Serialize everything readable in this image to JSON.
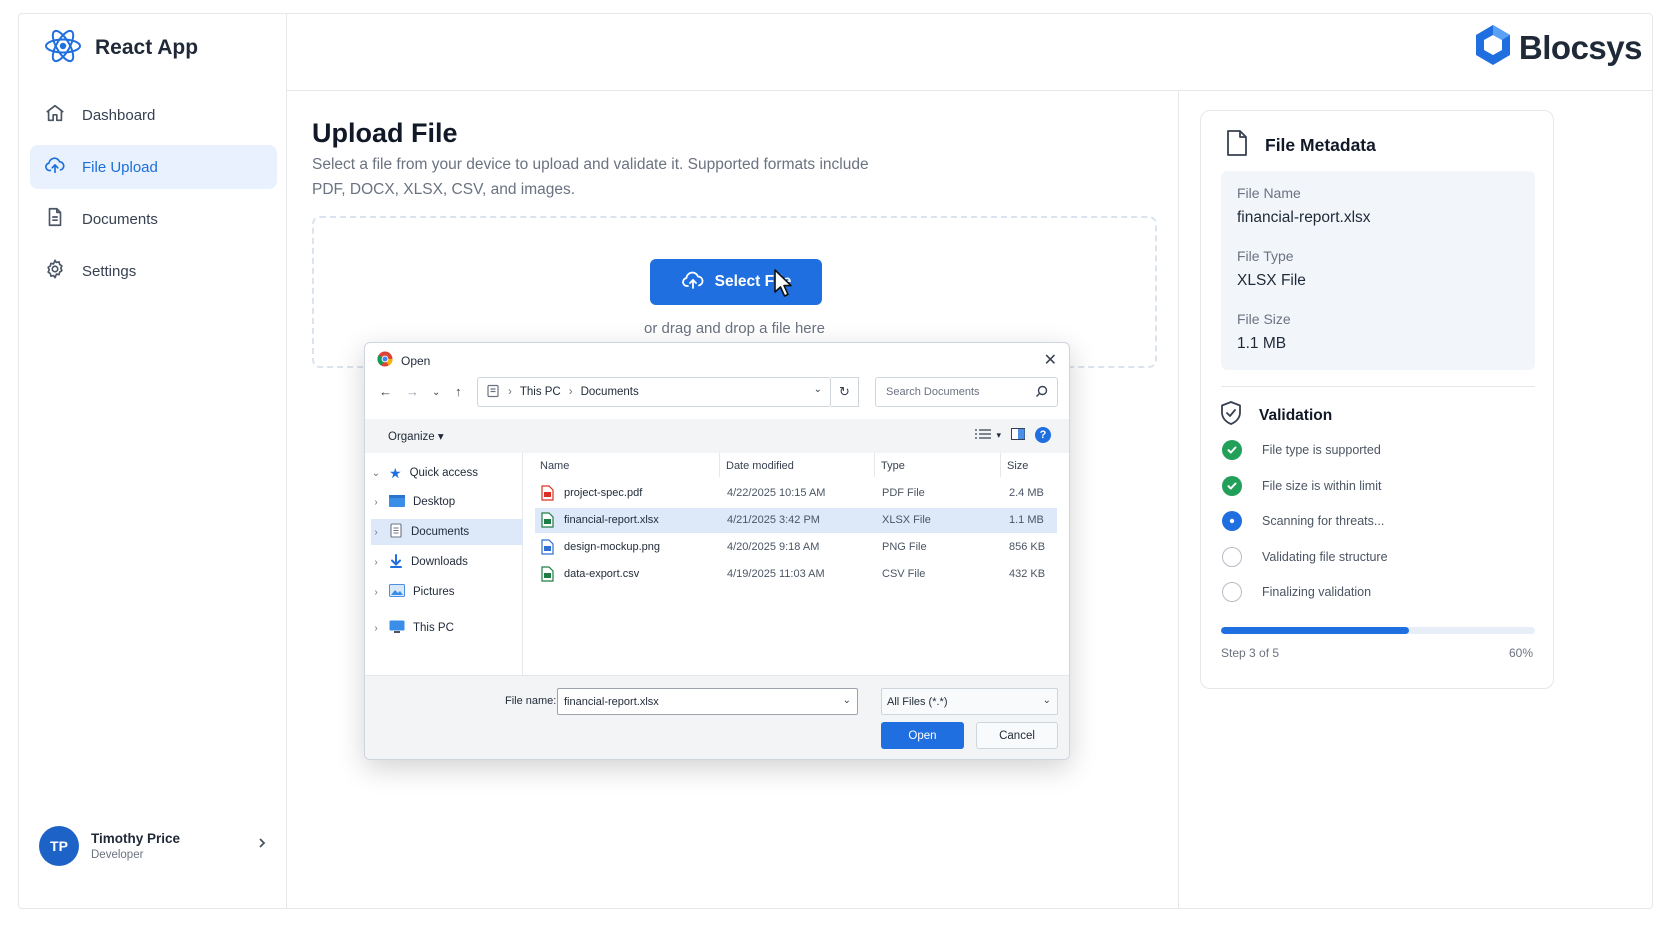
{
  "app": {
    "name": "React App"
  },
  "logo": {
    "text": "Blocsys"
  },
  "sidebar": {
    "items": [
      {
        "label": "Dashboard",
        "icon": "home-icon"
      },
      {
        "label": "File Upload",
        "icon": "cloud-upload-icon",
        "active": true
      },
      {
        "label": "Documents",
        "icon": "document-icon"
      },
      {
        "label": "Settings",
        "icon": "gear-icon"
      }
    ],
    "user": {
      "initials": "TP",
      "name": "Timothy Price",
      "role": "Developer"
    }
  },
  "main": {
    "title": "Upload File",
    "description": "Select a file from your device to upload and validate it. Supported formats include PDF, DOCX, XLSX, CSV, and images.",
    "select_button": "Select File",
    "drop_hint": "or drag and drop a file here"
  },
  "dialog": {
    "title": "Open",
    "breadcrumb": [
      "This PC",
      "Documents"
    ],
    "search_placeholder": "Search Documents",
    "organize_label": "Organize",
    "tree": [
      {
        "label": "Quick access",
        "icon": "star-icon"
      },
      {
        "label": "Desktop",
        "icon": "desktop-folder-icon"
      },
      {
        "label": "Documents",
        "icon": "documents-folder-icon",
        "selected": true
      },
      {
        "label": "Downloads",
        "icon": "download-icon"
      },
      {
        "label": "Pictures",
        "icon": "pictures-icon"
      },
      {
        "label": "This PC",
        "icon": "computer-icon"
      }
    ],
    "columns": [
      "Name",
      "Date modified",
      "Type",
      "Size"
    ],
    "files": [
      {
        "name": "project-spec.pdf",
        "date": "4/22/2025 10:15 AM",
        "type": "PDF File",
        "size": "2.4 MB",
        "icon": "pdf-file-icon"
      },
      {
        "name": "financial-report.xlsx",
        "date": "4/21/2025 3:42 PM",
        "type": "XLSX File",
        "size": "1.1 MB",
        "icon": "excel-file-icon",
        "selected": true
      },
      {
        "name": "design-mockup.png",
        "date": "4/20/2025 9:18 AM",
        "type": "PNG File",
        "size": "856 KB",
        "icon": "image-file-icon"
      },
      {
        "name": "data-export.csv",
        "date": "4/19/2025 11:03 AM",
        "type": "CSV File",
        "size": "432 KB",
        "icon": "csv-file-icon"
      }
    ],
    "file_name_label": "File name:",
    "file_name_value": "financial-report.xlsx",
    "file_type_value": "All Files (*.*)",
    "open_label": "Open",
    "cancel_label": "Cancel"
  },
  "metadata": {
    "title": "File Metadata",
    "fields": [
      {
        "label": "File Name",
        "value": "financial-report.xlsx"
      },
      {
        "label": "File Type",
        "value": "XLSX File"
      },
      {
        "label": "File Size",
        "value": "1.1 MB"
      }
    ]
  },
  "validation": {
    "title": "Validation",
    "steps": [
      {
        "label": "File type is supported",
        "status": "done"
      },
      {
        "label": "File size is within limit",
        "status": "done"
      },
      {
        "label": "Scanning for threats...",
        "status": "active"
      },
      {
        "label": "Validating file structure",
        "status": "pending"
      },
      {
        "label": "Finalizing validation",
        "status": "pending"
      }
    ],
    "progress_label": "Step 3 of 5",
    "progress_percent_label": "60%",
    "progress_fraction": 0.6
  },
  "colors": {
    "accent": "#1f6fe0",
    "success": "#22a05a",
    "active_nav_bg": "#e8f1fd"
  }
}
